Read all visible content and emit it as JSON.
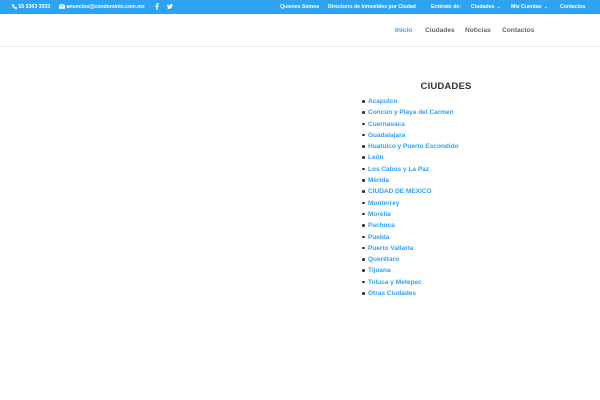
{
  "topbar": {
    "phone": "55 5363 3333",
    "email": "anuncios@condominio.com.mx",
    "social": [
      "facebook-icon",
      "twitter-icon"
    ],
    "links": [
      {
        "label": "Quienes Somos"
      },
      {
        "label": "Directorio de Inmuebles por Ciudad"
      },
      {
        "label": "Entérate de:"
      },
      {
        "label": "Ciudades",
        "dropdown": true
      },
      {
        "label": "Mis Cuentas",
        "dropdown": true
      },
      {
        "label": "Contactos"
      }
    ],
    "color": "#2ea3f2"
  },
  "main_nav": {
    "links": [
      {
        "label": "Inicio",
        "active": true
      },
      {
        "label": "Ciudades"
      },
      {
        "label": "Noticias"
      },
      {
        "label": "Contactos"
      }
    ]
  },
  "sidebar": {
    "title": "CIUDADES",
    "cities": [
      "Acapulco",
      "Concún y Playa del Carmen",
      "Cuernavaca",
      "Guadalajara",
      "Huatulco y Puerto Escondido",
      "León",
      "Los Cabos y La Paz",
      "Mérida",
      "CIUDAD DE MEXICO",
      "Monterrey",
      "Morelia",
      "Pachuca",
      "Puebla",
      "Puerto Vallarta",
      "Querétaro",
      "Tijuana",
      "Toluca y Metepec",
      "Otras Ciudades"
    ],
    "link_color": "#2ea3f2"
  }
}
